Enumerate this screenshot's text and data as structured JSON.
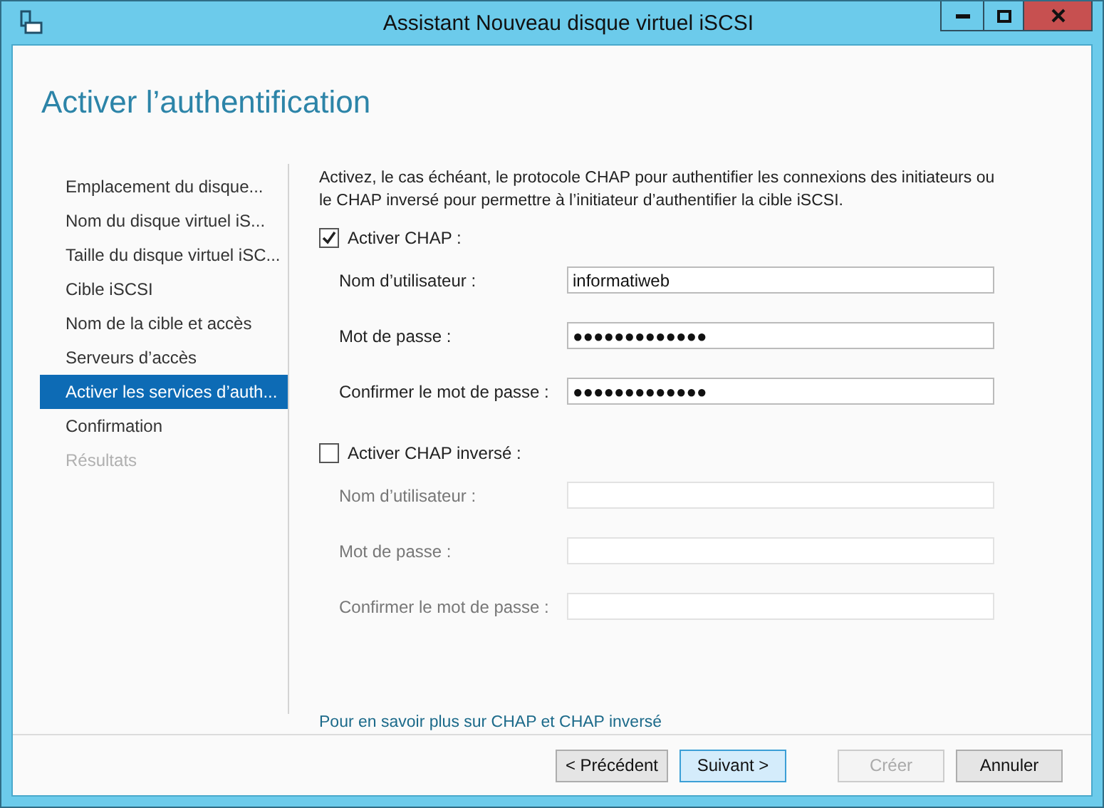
{
  "window": {
    "title": "Assistant Nouveau disque virtuel iSCSI"
  },
  "heading": "Activer l’authentification",
  "steps": [
    {
      "label": "Emplacement du disque...",
      "selected": false,
      "disabled": false
    },
    {
      "label": "Nom du disque virtuel iS...",
      "selected": false,
      "disabled": false
    },
    {
      "label": "Taille du disque virtuel iSC...",
      "selected": false,
      "disabled": false
    },
    {
      "label": "Cible iSCSI",
      "selected": false,
      "disabled": false
    },
    {
      "label": "Nom de la cible et accès",
      "selected": false,
      "disabled": false
    },
    {
      "label": "Serveurs d’accès",
      "selected": false,
      "disabled": false
    },
    {
      "label": "Activer les services d’auth...",
      "selected": true,
      "disabled": false
    },
    {
      "label": "Confirmation",
      "selected": false,
      "disabled": false
    },
    {
      "label": "Résultats",
      "selected": false,
      "disabled": true
    }
  ],
  "description": "Activez, le cas échéant, le protocole CHAP pour authentifier les connexions des initiateurs ou le CHAP inversé pour permettre à l’initiateur d’authentifier la cible iSCSI.",
  "sections": [
    {
      "label": "Activer CHAP :",
      "checked": true,
      "fields": [
        {
          "label": "Nom d’utilisateur :",
          "value": "informatiweb"
        },
        {
          "label": "Mot de passe :",
          "value": "●●●●●●●●●●●●●"
        },
        {
          "label": "Confirmer le mot de passe :",
          "value": "●●●●●●●●●●●●●"
        }
      ]
    },
    {
      "label": "Activer CHAP inversé :",
      "checked": false,
      "fields": [
        {
          "label": "Nom d’utilisateur :"
        },
        {
          "label": "Mot de passe :"
        },
        {
          "label": "Confirmer le mot de passe :"
        }
      ]
    }
  ],
  "help_link": "Pour en savoir plus sur CHAP et CHAP inversé",
  "buttons": [
    {
      "label": "< Précédent",
      "default": false,
      "disabled": false
    },
    {
      "label": "Suivant >",
      "default": true,
      "disabled": false
    },
    {
      "label": "Créer",
      "default": false,
      "disabled": true
    },
    {
      "label": "Annuler",
      "default": false,
      "disabled": false
    }
  ]
}
